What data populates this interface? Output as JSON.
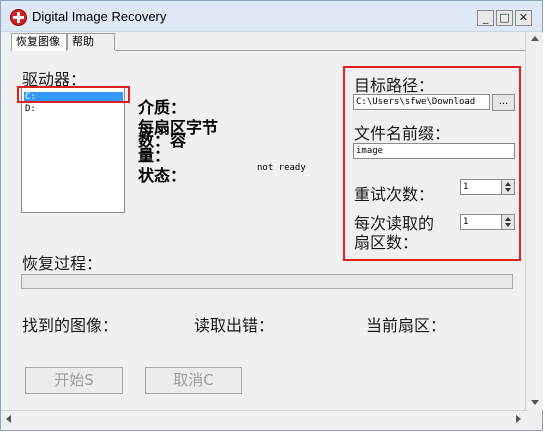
{
  "window": {
    "title": "Digital Image Recovery",
    "minimize": "_",
    "maximize": "□",
    "close": "✕"
  },
  "tabs": [
    {
      "label": "恢复图像",
      "active": true
    },
    {
      "label": "帮助",
      "active": false
    }
  ],
  "drives": {
    "label": "驱动器：",
    "items": [
      "C:",
      "D:"
    ],
    "selected": "C:"
  },
  "info": {
    "media": "介质：",
    "bytes_per_sector": "每扇区字节",
    "capacity": "数：容量：",
    "status": "状态：",
    "status_value": "not ready"
  },
  "target": {
    "path_label": "目标路径：",
    "path_value": "C:\\Users\\sfwe\\Download",
    "browse": "...",
    "prefix_label": "文件名前缀：",
    "prefix_value": "image",
    "retry_label": "重试次数：",
    "retry_value": "1",
    "sectors_label_line1": "每次读取的",
    "sectors_label_line2": "扇区数：",
    "sectors_value": "1"
  },
  "progress": {
    "label": "恢复过程：",
    "value": 0
  },
  "counters": {
    "found": "找到的图像：",
    "errors": "读取出错：",
    "current": "当前扇区："
  },
  "buttons": {
    "start": "开始S",
    "cancel": "取消C"
  },
  "colors": {
    "highlight_box": "#e0201e",
    "selection": "#3399ff"
  }
}
